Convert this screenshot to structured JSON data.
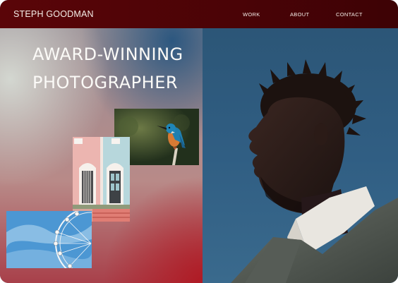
{
  "header": {
    "brand": "STEPH GOODMAN",
    "nav": {
      "work": "WORK",
      "about": "ABOUT",
      "contact": "CONTACT"
    }
  },
  "hero": {
    "headline_line1": "AWARD-WINNING",
    "headline_line2": "PHOTOGRAPHER"
  },
  "colors": {
    "navbar": "#4a0306",
    "sky": "#2f5a7c",
    "accent_red": "#b01822",
    "text_light": "#f4eee8"
  }
}
